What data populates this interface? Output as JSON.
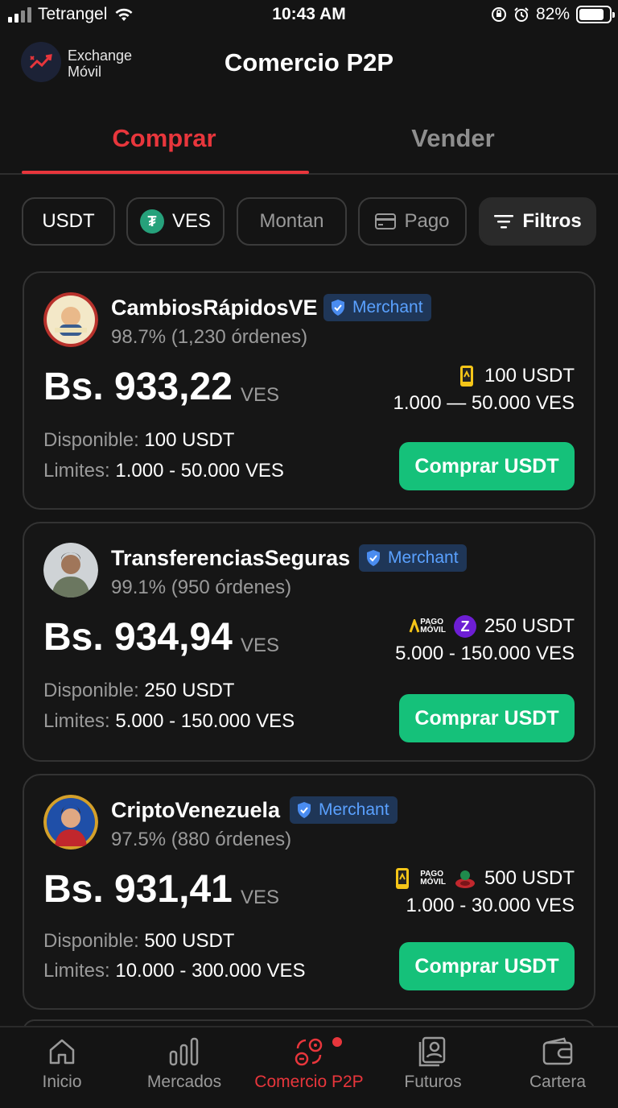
{
  "status_bar": {
    "carrier": "Tetrangel",
    "time": "10:43 AM",
    "battery": "82%",
    "battery_level": 0.82
  },
  "header": {
    "logo_line1": "Exchange",
    "logo_line2": "Móvil",
    "title": "Comercio P2P"
  },
  "tabs": [
    {
      "label": "Comprar",
      "active": true
    },
    {
      "label": "Vender",
      "active": false
    }
  ],
  "filters": {
    "asset": "USDT",
    "fiat": "VES",
    "amount_placeholder": "Montan",
    "payment": "Pago",
    "filters_label": "Filtros"
  },
  "offers": [
    {
      "name": "CambiosRápidosVE",
      "badge": "Merchant",
      "rating": "98.7% (1,230 órdenes)",
      "price": "Bs. 933,22",
      "price_unit": "VES",
      "pay_amount": "100 USDT",
      "pay_range": "1.000 — 50.000 VES",
      "available_label": "Disponible:",
      "available_value": "100 USDT",
      "limits_label": "Limites:",
      "limits_value": "1.000 - 50.000 VES",
      "button": "Comprar USDT",
      "payment_icons": [
        "pago-movil-phone-icon"
      ]
    },
    {
      "name": "TransferenciasSeguras",
      "badge": "Merchant",
      "rating": "99.1% (950 órdenes)",
      "price": "Bs. 934,94",
      "price_unit": "VES",
      "pay_amount": "250 USDT",
      "pay_range": "5.000 - 150.000 VES",
      "available_label": "Disponible:",
      "available_value": "250 USDT",
      "limits_label": "Limites:",
      "limits_value": "5.000 - 150.000 VES",
      "button": "Comprar USDT",
      "payment_icons": [
        "pago-movil-logo",
        "zelle-icon"
      ],
      "pago_movil_text": [
        "PAGO",
        "MÓVIL"
      ],
      "zelle_glyph": "Z"
    },
    {
      "name": "CriptoVenezuela",
      "badge": "Merchant",
      "rating": "97.5% (880 órdenes)",
      "price": "Bs. 931,41",
      "price_unit": "VES",
      "pay_amount": "500 USDT",
      "pay_range": "1.000 - 30.000 VES",
      "available_label": "Disponible:",
      "available_value": "500 USDT",
      "limits_label": "Limites:",
      "limits_value": "10.000 - 300.000 VES",
      "button": "Comprar USDT",
      "payment_icons": [
        "pago-movil-phone-icon",
        "pago-movil-logo",
        "bank-icon"
      ],
      "pago_movil_text": [
        "PAGO",
        "MÓVIL"
      ]
    }
  ],
  "bottom_nav": [
    {
      "label": "Inicio",
      "icon": "home-icon",
      "active": false
    },
    {
      "label": "Mercados",
      "icon": "bar-chart-icon",
      "active": false
    },
    {
      "label": "Comercio P2P",
      "icon": "p2p-exchange-icon",
      "active": true
    },
    {
      "label": "Futuros",
      "icon": "futures-icon",
      "active": false
    },
    {
      "label": "Cartera",
      "icon": "wallet-icon",
      "active": false
    }
  ],
  "colors": {
    "accent_red": "#e8363c",
    "buy_green": "#15c17a",
    "merchant_blue": "#5aa1ff",
    "background": "#141414"
  }
}
